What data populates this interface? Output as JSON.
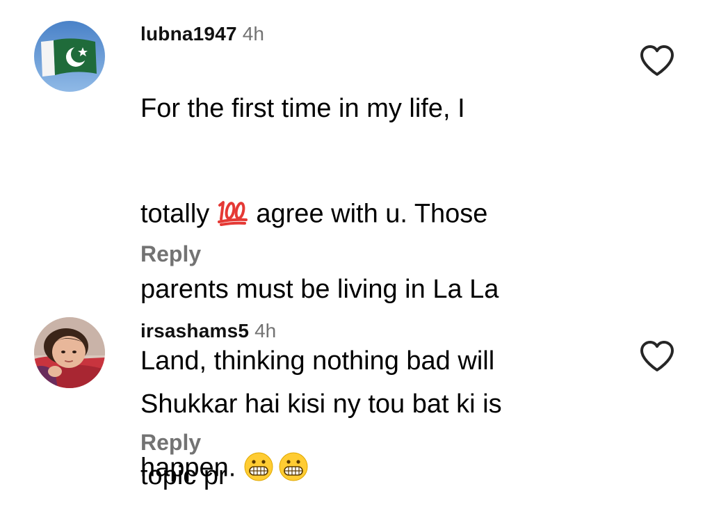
{
  "comments": [
    {
      "username": "lubna1947",
      "time": "4h",
      "text_lines": [
        "For the first time in my life, I",
        "totally ",
        " agree with u. Those",
        "parents must be living in La La",
        "Land, thinking nothing bad will",
        "happen. "
      ],
      "emoji_1": "💯",
      "emoji_2": "😬😬",
      "reply_label": "Reply",
      "avatar_icon": "pakistan-flag-avatar",
      "like_icon": "heart-outline-icon"
    },
    {
      "username": "irsashams5",
      "time": "4h",
      "text_lines": [
        "Shukkar hai kisi ny tou bat ki is",
        "topic pr"
      ],
      "reply_label": "Reply",
      "avatar_icon": "child-photo-avatar",
      "like_icon": "heart-outline-icon"
    }
  ],
  "colors": {
    "text": "#000000",
    "username": "#111111",
    "secondary": "#737373",
    "background": "#ffffff"
  }
}
